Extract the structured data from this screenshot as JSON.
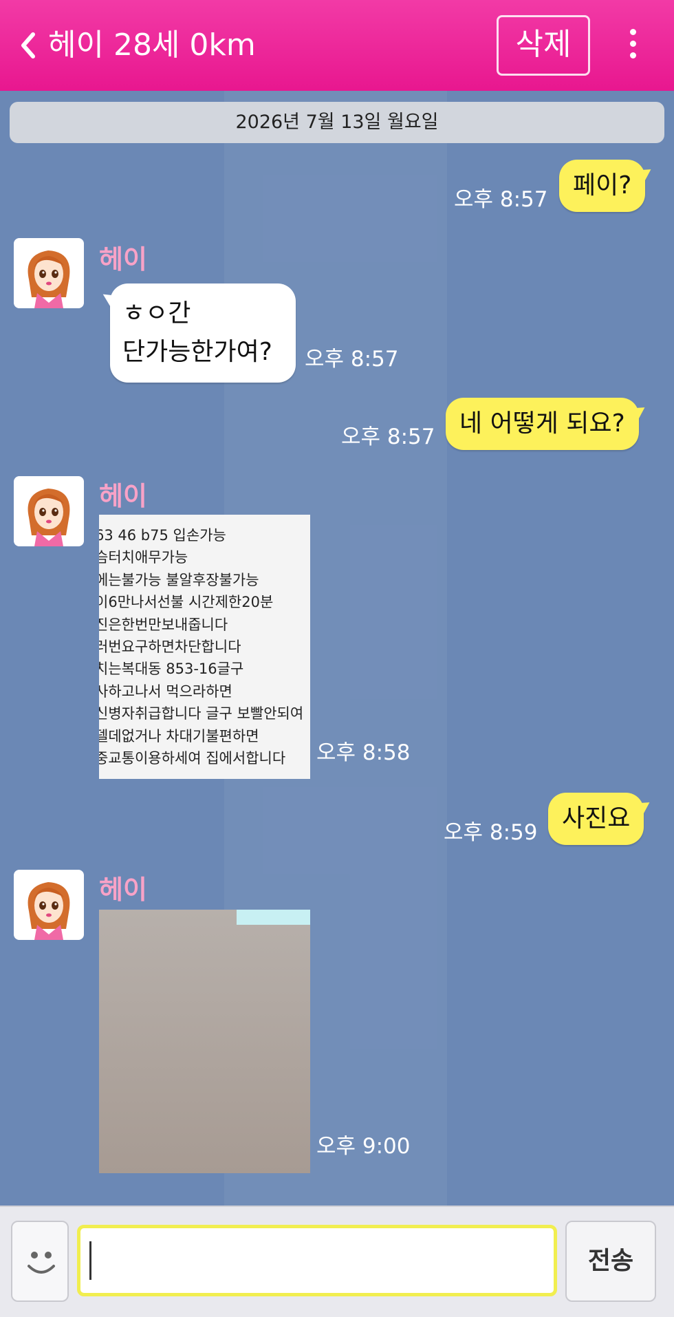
{
  "header": {
    "title": "헤이 28세 0km",
    "delete_label": "삭제"
  },
  "date_separator": "2026년 7월 13일 월요일",
  "messages": [
    {
      "from": "me",
      "text": "페이?",
      "time": "오후 8:57"
    },
    {
      "from": "them",
      "sender": "헤이",
      "lines": [
        "ㅎㅇ간",
        "단가능한가여?"
      ],
      "time": "오후 8:57"
    },
    {
      "from": "me",
      "text": "네 어떻게 되요?",
      "time": "오후 8:57"
    },
    {
      "from": "them",
      "sender": "헤이",
      "type": "image",
      "image_lines": [
        "63 46 b75 입손가능",
        "슴터치애무가능",
        "에는불가능 불알후장불가능",
        "이6만나서선불 시간제한20분",
        "진은한번만보내줍니다",
        "러번요구하면차단합니다",
        "치는복대동 853-16글구",
        "사하고나서 먹으라하면",
        "신병자취급합니다 글구 보빨안되여",
        "델데없거나 차대기불편하면",
        "중교통이용하세여 집에서합니다"
      ],
      "time": "오후 8:58"
    },
    {
      "from": "me",
      "text": "사진요",
      "time": "오후 8:59"
    },
    {
      "from": "them",
      "sender": "헤이",
      "type": "image",
      "image_kind": "photo",
      "time": "오후 9:00"
    }
  ],
  "input": {
    "value": "",
    "send_label": "전송"
  },
  "colors": {
    "header": "#ee2a9b",
    "chat_bg": "#6b88b5",
    "my_bubble": "#fdf15b",
    "their_bubble": "#ffffff",
    "sender_name": "#f8a2c7"
  }
}
